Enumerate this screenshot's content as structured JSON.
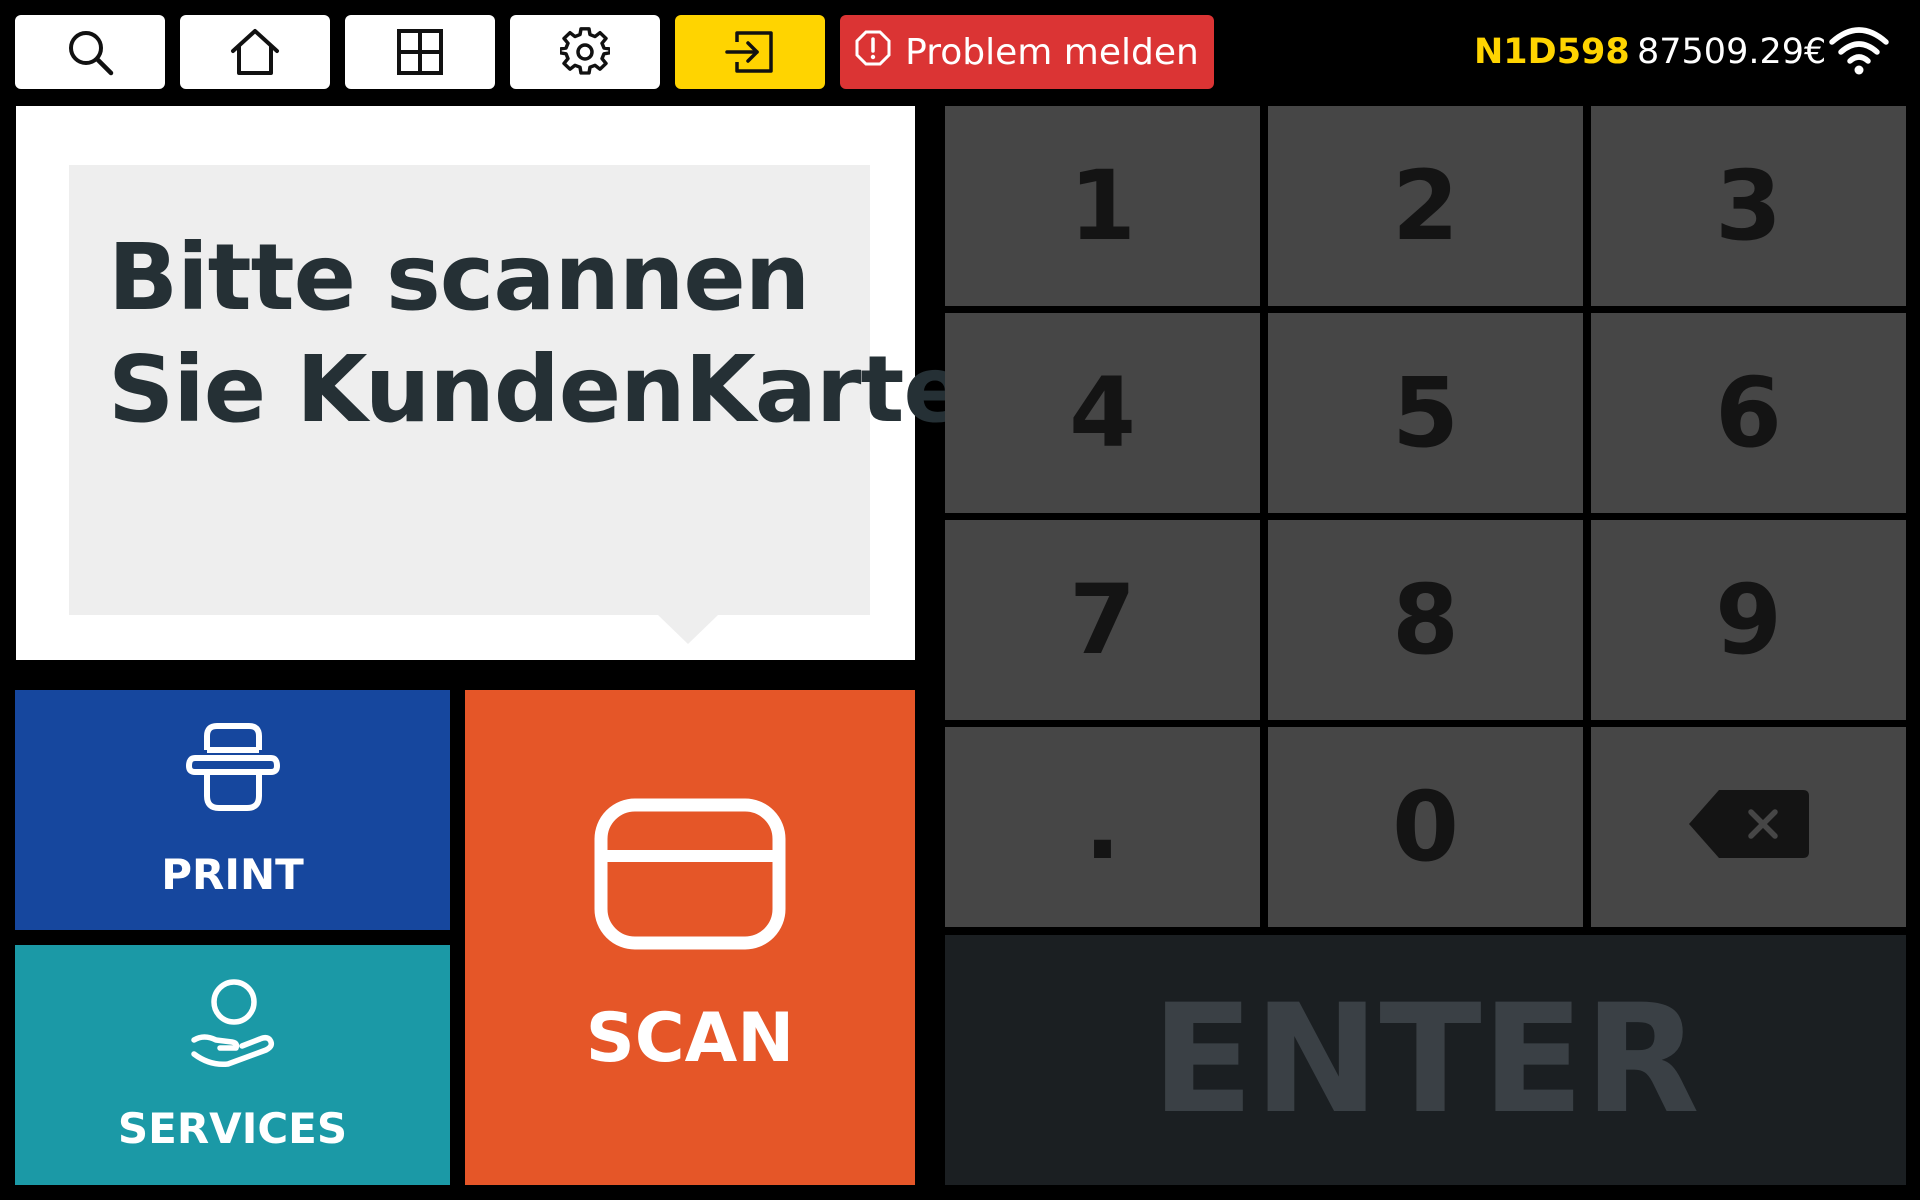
{
  "toolbar": {
    "problem_label": "Problem melden",
    "colors": {
      "exit_button": "#ffd400",
      "problem_button": "#db3434"
    }
  },
  "status": {
    "terminal_id": "N1D598",
    "balance": "87509.29€"
  },
  "message": {
    "line1": "Bitte scannen",
    "line2": "Sie KundenKarte"
  },
  "actions": {
    "print_label": "PRINT",
    "services_label": "SERVICES",
    "scan_label": "SCAN",
    "colors": {
      "print": "#16479e",
      "services": "#1b99a6",
      "scan": "#e55628"
    }
  },
  "keypad": {
    "keys": [
      "1",
      "2",
      "3",
      "4",
      "5",
      "6",
      "7",
      "8",
      "9",
      ".",
      "0"
    ],
    "enter_label": "ENTER"
  }
}
